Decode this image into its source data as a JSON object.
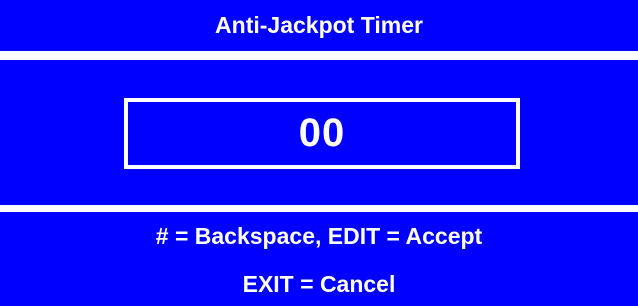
{
  "colors": {
    "panel_background": "#0000ff",
    "text": "#ffffff",
    "border": "#ffffff"
  },
  "header": {
    "title": "Anti-Jackpot Timer"
  },
  "main": {
    "value": "00"
  },
  "footer": {
    "hint_line_1": "# = Backspace, EDIT = Accept",
    "hint_line_2": "EXIT = Cancel"
  }
}
